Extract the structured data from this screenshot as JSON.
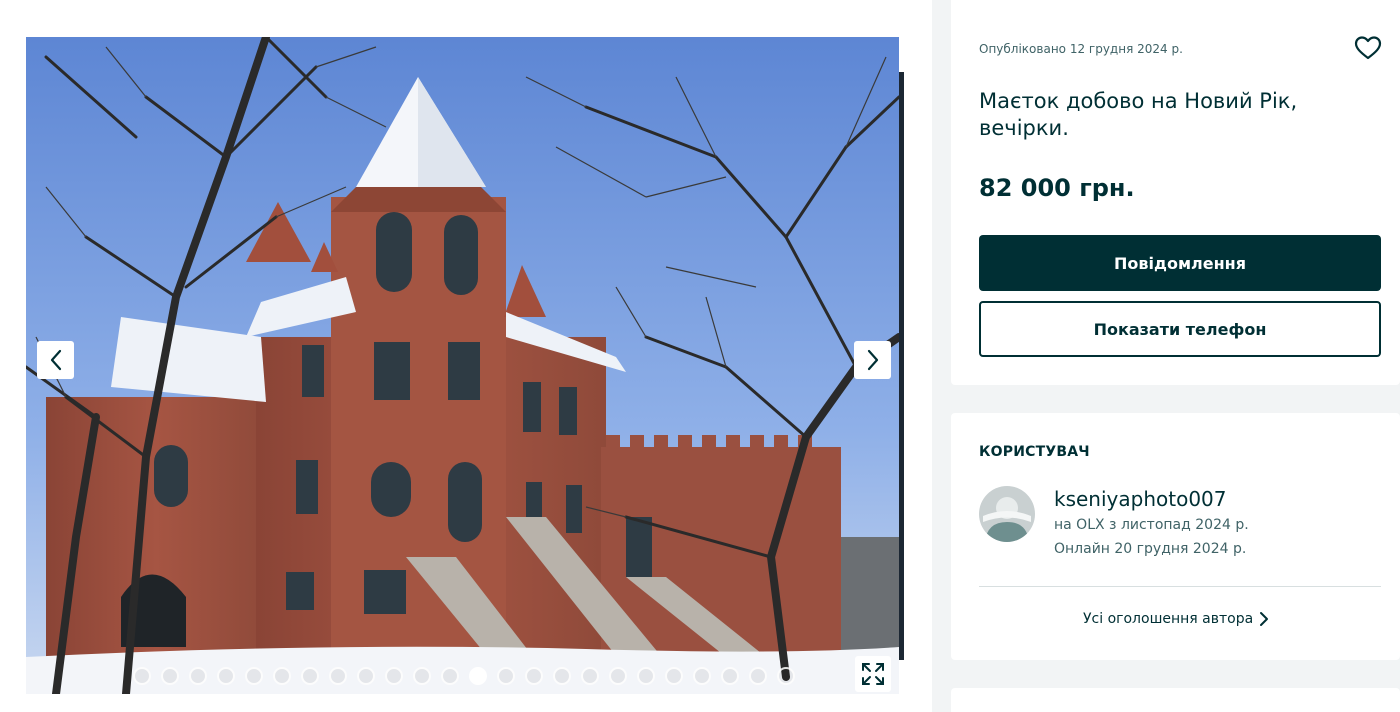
{
  "gallery": {
    "photo_icon": "house-photo",
    "photo_count": 24,
    "active_index": 12,
    "prev_icon": "chevron-left-icon",
    "next_icon": "chevron-right-icon",
    "expand_icon": "expand-icon"
  },
  "listing": {
    "published": "Опубліковано 12 грудня 2024 р.",
    "title": "Маєток добово на Новий Рік, вечірки.",
    "price": "82 000 грн.",
    "message_button": "Повідомлення",
    "phone_button": "Показати телефон",
    "favorite_icon": "heart-icon"
  },
  "user": {
    "section_label": "КОРИСТУВАЧ",
    "name": "kseniyaphoto007",
    "since": "на OLX з листопад 2024 р.",
    "online": "Онлайн 20 грудня 2024 р.",
    "all_ads": "Усі оголошення автора",
    "avatar_icon": "avatar-icon"
  },
  "colors": {
    "primary": "#002f34",
    "background": "#f2f4f5",
    "muted_text": "#406367"
  }
}
